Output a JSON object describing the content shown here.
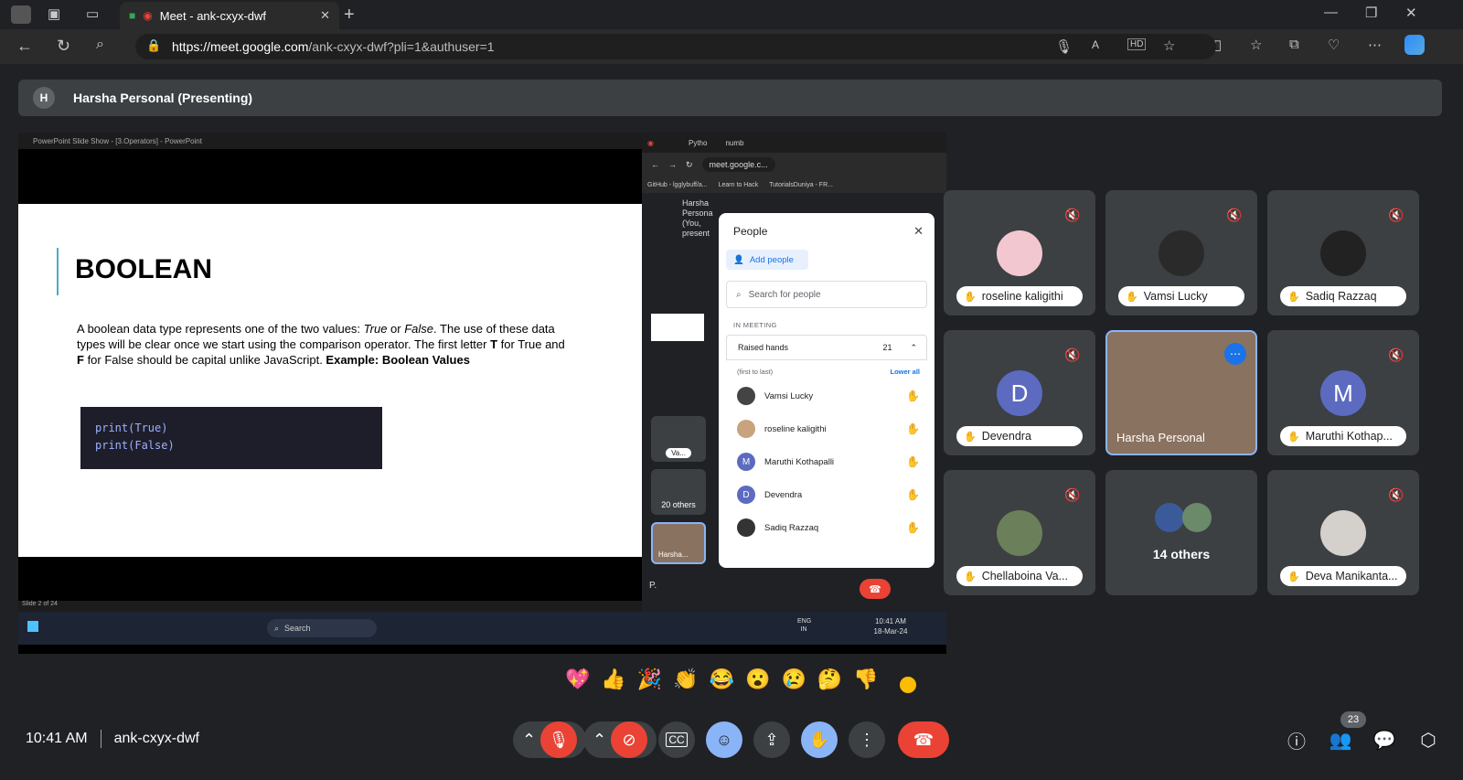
{
  "browser": {
    "tab_title": "Meet - ank-cxyx-dwf",
    "url_domain": "https://meet.google.com",
    "url_path": "/ank-cxyx-dwf?pli=1&authuser=1"
  },
  "presenting": {
    "avatar_letter": "H",
    "label": "Harsha Personal (Presenting)"
  },
  "screen": {
    "ppt_window_title": "PowerPoint Slide Show - [3.Operators] - PowerPoint",
    "slide_title": "BOOLEAN",
    "slide_text_1": "A boolean data type represents one of the two values: ",
    "slide_true": "True",
    "slide_or": " or ",
    "slide_false": "False",
    "slide_text_2": ". The use of these data types will be clear once we start using the comparison operator. The first letter ",
    "slide_T": "T",
    "slide_text_3": " for True and ",
    "slide_F": "F",
    "slide_text_4": " for False should be capital unlike JavaScript. ",
    "slide_example": "Example: Boolean Values",
    "code_line_1": "print(True)",
    "code_line_2": "print(False)",
    "slide_counter": "Slide 2 of 24",
    "taskbar_search": "Search",
    "taskbar_lang": "ENG IN",
    "taskbar_time": "10:41 AM",
    "taskbar_date": "18-Mar-24",
    "inner_tab_2": "Pytho",
    "inner_tab_3": "numb",
    "inner_url": "meet.google.c...",
    "bookmark_1": "GitHub - lgglybuff/a...",
    "bookmark_2": "Learn to Hack",
    "bookmark_3": "TutorialsDuniya - FR...",
    "inner_presenter": "Harsha Persona (You, present",
    "inner_tile_name": "Va...",
    "inner_others": "20 others",
    "inner_self_name": "Harsha...",
    "inner_self_initial": "P."
  },
  "people_panel": {
    "title": "People",
    "add_people": "Add people",
    "search_placeholder": "Search for people",
    "section": "IN MEETING",
    "raised_hands_label": "Raised hands",
    "raised_hands_count": "21",
    "order_note": "(first to last)",
    "lower_all": "Lower all",
    "list": [
      {
        "name": "Vamsi Lucky",
        "initial": "",
        "color": "#444"
      },
      {
        "name": "roseline kaligithi",
        "initial": "",
        "color": "#c9a27e"
      },
      {
        "name": "Maruthi Kothapalli",
        "initial": "M",
        "color": "#5c6bc0"
      },
      {
        "name": "Devendra",
        "initial": "D",
        "color": "#5c6bc0"
      },
      {
        "name": "Sadiq Razzaq",
        "initial": "",
        "color": "#333"
      }
    ]
  },
  "tiles": [
    {
      "name": "roseline kaligithi",
      "initial": "",
      "color": "#f3c7d0"
    },
    {
      "name": "Vamsi Lucky",
      "initial": "",
      "color": "#2a2a2a"
    },
    {
      "name": "Sadiq Razzaq",
      "initial": "",
      "color": "#222"
    },
    {
      "name": "Devendra",
      "initial": "D",
      "color": "#5c6bc0"
    },
    {
      "name": "Harsha Personal",
      "initial": "",
      "color": "#8a7260"
    },
    {
      "name": "Maruthi Kothap...",
      "initial": "M",
      "color": "#5c6bc0"
    },
    {
      "name": "Chellaboina Va...",
      "initial": "",
      "color": "#6b7f5a"
    },
    {
      "name": "14 others",
      "initial": "",
      "color": ""
    },
    {
      "name": "Deva Manikanta...",
      "initial": "",
      "color": "#d4d0cc"
    }
  ],
  "reactions": [
    "💖",
    "👍",
    "🎉",
    "👏",
    "😂",
    "😮",
    "😢",
    "🤔",
    "👎"
  ],
  "bottom": {
    "time": "10:41 AM",
    "meeting_code": "ank-cxyx-dwf",
    "participant_count": "23"
  }
}
